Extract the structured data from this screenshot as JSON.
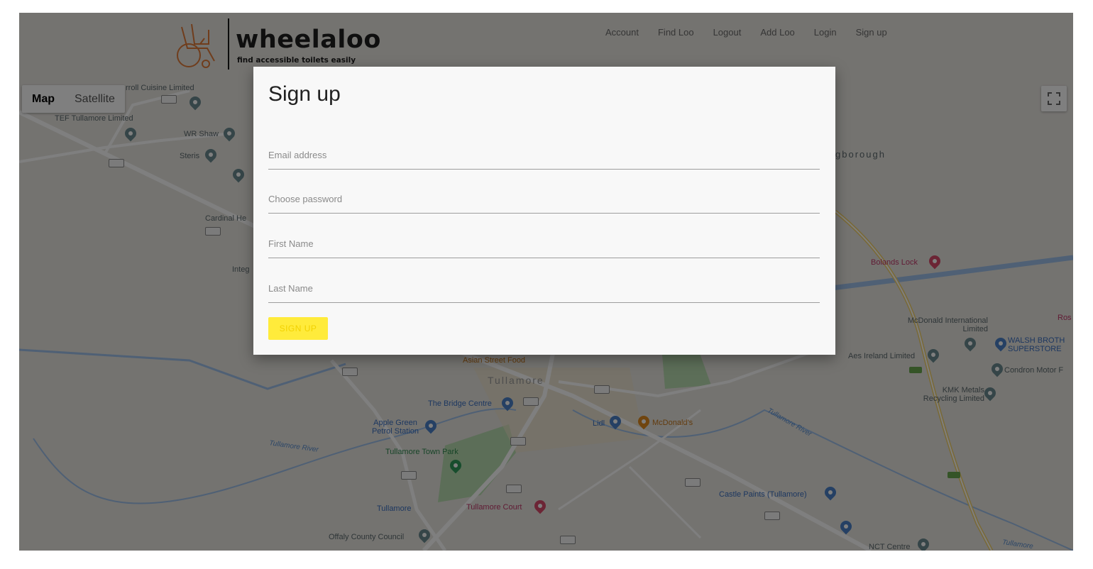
{
  "brand": {
    "name": "wheelaloo",
    "tagline": "find accessible toilets easily"
  },
  "nav": {
    "items": [
      {
        "label": "Account"
      },
      {
        "label": "Find Loo"
      },
      {
        "label": "Logout"
      },
      {
        "label": "Add Loo"
      },
      {
        "label": "Login"
      },
      {
        "label": "Sign up"
      }
    ]
  },
  "map": {
    "controls": {
      "map_label": "Map",
      "satellite_label": "Satellite",
      "active": "Map"
    },
    "labels": {
      "carroll": "rroll Cuisine Limited",
      "tef": "TEF Tullamore Limited",
      "wrshaw": "WR Shaw",
      "steris": "Steris",
      "cardinal": "Cardinal He",
      "integ": "Integ",
      "gborough": "gborough",
      "bolands": "Bolands Lock",
      "mcdonald_intl": "McDonald International Limited",
      "walsh": "WALSH BROTH SUPERSTORE",
      "ros": "Ros",
      "aes": "Aes Ireland Limited",
      "condron": "Condron Motor F",
      "kmk": "KMK Metals Recycling Limited",
      "asian": "Asian Street Food",
      "tullamore_town": "Tullamore",
      "bridge": "The Bridge Centre",
      "applegreen": "Apple Green Petrol Station",
      "lidl": "Lidl",
      "mcdonalds": "McDonald's",
      "tullamore_river_left": "Tullamore River",
      "tullamore_river_right": "Tullamore River",
      "town_park": "Tullamore Town Park",
      "tullamore_bus": "Tullamore",
      "tullamore_court": "Tullamore Court",
      "castle_paints": "Castle Paints (Tullamore)",
      "offaly": "Offaly County Council",
      "nct": "NCT Centre",
      "tullamore_river_corner": "Tullamore"
    }
  },
  "dialog": {
    "title": "Sign up",
    "fields": {
      "email": {
        "placeholder": "Email address",
        "value": ""
      },
      "password": {
        "placeholder": "Choose password",
        "value": ""
      },
      "first_name": {
        "placeholder": "First Name",
        "value": ""
      },
      "last_name": {
        "placeholder": "Last Name",
        "value": ""
      }
    },
    "submit_label": "SIGN UP"
  },
  "colors": {
    "accent_yellow": "#ffeb3b",
    "logo_orange": "#e07b39",
    "overlay": "#000000"
  }
}
